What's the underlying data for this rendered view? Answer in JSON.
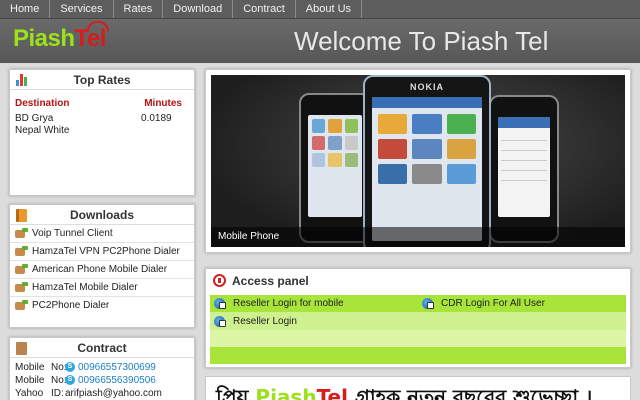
{
  "nav": {
    "items": [
      {
        "label": "Home"
      },
      {
        "label": "Services"
      },
      {
        "label": "Rates"
      },
      {
        "label": "Download"
      },
      {
        "label": "Contract"
      },
      {
        "label": "About Us"
      }
    ]
  },
  "header": {
    "logo_main": "Piash",
    "logo_accent": "Tel",
    "welcome": "Welcome To Piash Tel"
  },
  "top_rates": {
    "title": "Top Rates",
    "col_destination": "Destination",
    "col_minutes": "Minutes",
    "rows": [
      {
        "destination": "BD Grya",
        "minutes": "0.0189"
      },
      {
        "destination": "Nepal White",
        "minutes": ""
      }
    ]
  },
  "downloads": {
    "title": "Downloads",
    "items": [
      {
        "label": "Voip Tunnel Client"
      },
      {
        "label": "HamzaTel VPN PC2Phone Dialer"
      },
      {
        "label": "American Phone Mobile Dialer"
      },
      {
        "label": "HamzaTel Mobile Dialer"
      },
      {
        "label": "PC2Phone Dialer"
      }
    ]
  },
  "contract": {
    "title": "Contract",
    "rows": [
      {
        "key": "Mobile",
        "sep": "No:",
        "value": "00966557300699",
        "skype": true
      },
      {
        "key": "Mobile",
        "sep": "No:",
        "value": "00966556390506",
        "skype": true
      },
      {
        "key": "Yahoo",
        "sep": "ID:",
        "value": "arifpiash@yahoo.com",
        "skype": false
      }
    ]
  },
  "slider": {
    "caption": "Mobile Phone",
    "phone_brand": "NOKIA"
  },
  "access_panel": {
    "title": "Access panel",
    "links": [
      {
        "label": "Reseller Login for mobile"
      },
      {
        "label": "CDR Login For All User"
      },
      {
        "label": "Reseller Login"
      }
    ]
  },
  "banner": {
    "prefix": "প্রিয় ",
    "logo_main": "Piash",
    "logo_accent": "Tel",
    "suffix": " গ্রাহক নতুন বছরের শুভেচ্ছা ।"
  },
  "colors": {
    "accent_green": "#9be21a",
    "accent_red": "#d81b1b",
    "nav_bg": "#5d5d5d",
    "access_lime": "#a8e43a"
  }
}
